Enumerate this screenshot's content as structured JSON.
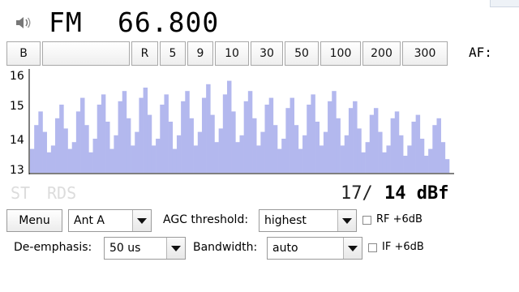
{
  "header": {
    "band": "FM",
    "frequency": "66.800",
    "speaker_icon": "speaker-icon"
  },
  "toolbar": {
    "buttons": [
      "B",
      "",
      "R",
      "5",
      "9",
      "10",
      "30",
      "50",
      "100",
      "200",
      "300"
    ],
    "af_label": "AF:"
  },
  "chart_data": {
    "type": "area",
    "title": "",
    "xlabel": "",
    "ylabel": "",
    "ylim": [
      13,
      16
    ],
    "yticks": [
      "16",
      "15",
      "14",
      "13"
    ],
    "grid": false,
    "fill_color": "#b3b8ee",
    "series": [
      {
        "values": [
          13.7,
          14.4,
          14.8,
          14.2,
          13.6,
          13.8,
          14.6,
          15.0,
          14.3,
          13.7,
          13.9,
          14.8,
          15.2,
          14.4,
          13.6,
          14.0,
          15.0,
          15.3,
          14.5,
          13.7,
          14.1,
          15.1,
          15.4,
          14.6,
          13.8,
          14.2,
          15.2,
          15.5,
          14.7,
          13.8,
          14.0,
          15.0,
          15.3,
          14.5,
          13.7,
          14.1,
          15.1,
          15.4,
          14.6,
          13.8,
          14.2,
          15.2,
          15.6,
          14.7,
          13.9,
          14.3,
          15.3,
          15.7,
          14.8,
          13.9,
          14.1,
          15.1,
          15.4,
          14.6,
          13.8,
          14.2,
          15.0,
          15.2,
          14.4,
          13.7,
          14.0,
          14.9,
          15.2,
          14.4,
          13.7,
          14.1,
          15.0,
          15.3,
          14.5,
          13.8,
          14.2,
          15.1,
          15.4,
          14.6,
          13.8,
          14.1,
          14.9,
          15.1,
          14.3,
          13.6,
          13.9,
          14.7,
          14.9,
          14.2,
          13.6,
          13.8,
          14.6,
          14.8,
          14.1,
          13.5,
          13.8,
          14.5,
          14.7,
          14.0,
          13.5,
          13.7,
          14.4,
          14.6,
          13.9,
          13.4
        ]
      }
    ]
  },
  "status": {
    "stereo": "ST",
    "rds": "RDS",
    "signal_current": "17/",
    "signal_max": "14 dBf"
  },
  "row1": {
    "menu_label": "Menu",
    "antenna_value": "Ant A",
    "agc_label": "AGC threshold:",
    "agc_value": "highest",
    "rf_label": "RF +6dB"
  },
  "row2": {
    "deemphasis_label": "De-emphasis:",
    "deemphasis_value": "50 us",
    "bandwidth_label": "Bandwidth:",
    "bandwidth_value": "auto",
    "if_label": "IF +6dB"
  }
}
